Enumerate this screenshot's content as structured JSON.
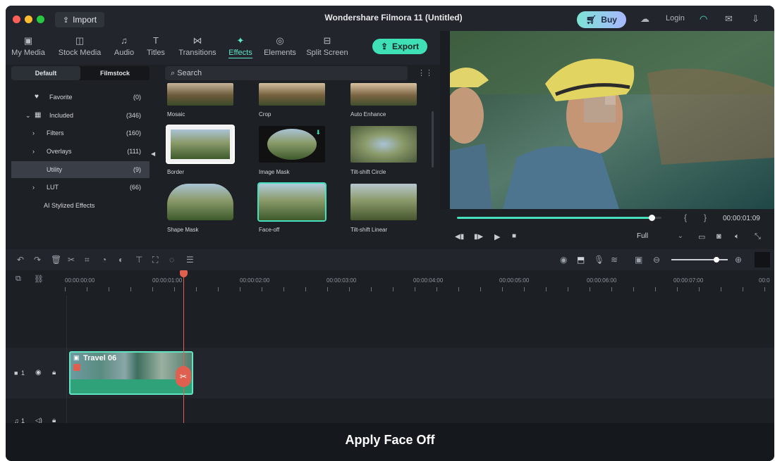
{
  "window": {
    "title": "Wondershare Filmora 11 (Untitled)"
  },
  "titlebar": {
    "import_label": "Import",
    "buy_label": "Buy",
    "login_label": "Login"
  },
  "tabs": [
    {
      "label": "My Media",
      "icon": "image-icon"
    },
    {
      "label": "Stock Media",
      "icon": "camera-icon"
    },
    {
      "label": "Audio",
      "icon": "music-icon"
    },
    {
      "label": "Titles",
      "icon": "text-icon"
    },
    {
      "label": "Transitions",
      "icon": "transition-icon"
    },
    {
      "label": "Effects",
      "icon": "sparkle-icon",
      "active": true
    },
    {
      "label": "Elements",
      "icon": "elements-icon"
    },
    {
      "label": "Split Screen",
      "icon": "split-icon"
    }
  ],
  "export_label": "Export",
  "library": {
    "segments": [
      "Default",
      "Filmstock"
    ],
    "search_placeholder": "Search",
    "categories": [
      {
        "name": "Favorite",
        "count": "(0)"
      },
      {
        "name": "Included",
        "count": "(346)"
      },
      {
        "name": "Filters",
        "count": "(160)"
      },
      {
        "name": "Overlays",
        "count": "(111)"
      },
      {
        "name": "Utility",
        "count": "(9)"
      },
      {
        "name": "LUT",
        "count": "(66)"
      },
      {
        "name": "AI Stylized Effects",
        "count": ""
      }
    ],
    "effects": [
      "Mosaic",
      "Crop",
      "Auto Enhance",
      "Border",
      "Image Mask",
      "Tilt-shift Circle",
      "Shape Mask",
      "Face-off",
      "Tilt-shift Linear"
    ]
  },
  "player": {
    "timecode": "00:00:01:09",
    "quality": "Full",
    "progress": 0.95
  },
  "timeline": {
    "ticks": [
      "00:00:00:00",
      "00:00:01:00",
      "00:00:02:00",
      "00:00:03:00",
      "00:00:04:00",
      "00:00:05:00",
      "00:00:06:00",
      "00:00:07:00",
      "00:0"
    ],
    "clip_label": "Travel 06",
    "video_track": "1",
    "audio_track": "1"
  },
  "caption": "Apply Face Off",
  "colors": {
    "accent": "#3fe0b6",
    "playhead": "#e0604f",
    "clip": "#2fa27a"
  }
}
